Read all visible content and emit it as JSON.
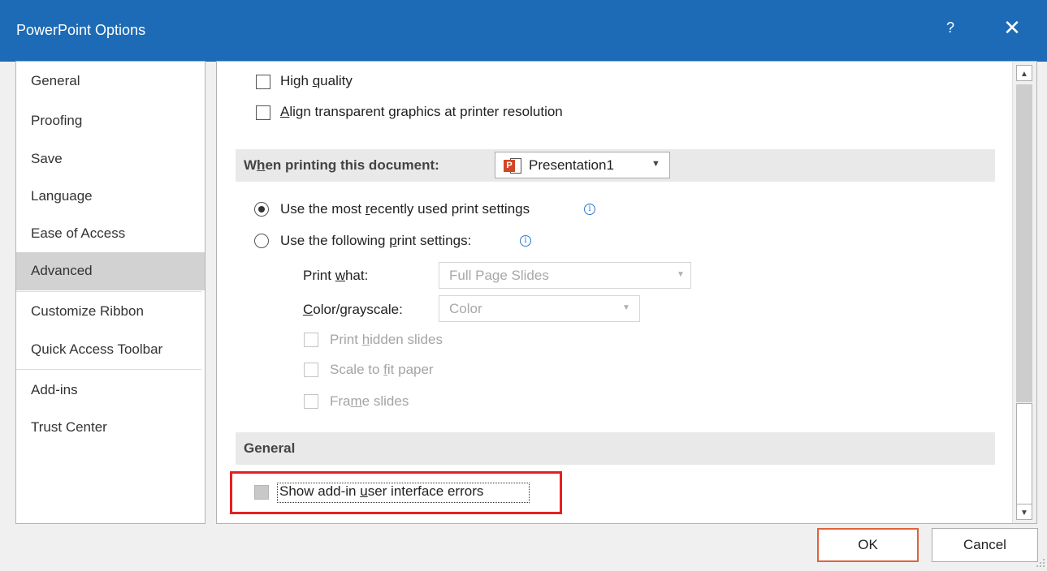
{
  "window": {
    "title": "PowerPoint Options",
    "help_label": "?",
    "close_label": "✕"
  },
  "sidebar": {
    "items": [
      {
        "label": "General"
      },
      {
        "label": "Proofing"
      },
      {
        "label": "Save"
      },
      {
        "label": "Language"
      },
      {
        "label": "Ease of Access"
      },
      {
        "label": "Advanced",
        "selected": true
      },
      {
        "label": "Customize Ribbon"
      },
      {
        "label": "Quick Access Toolbar"
      },
      {
        "label": "Add-ins"
      },
      {
        "label": "Trust Center"
      }
    ]
  },
  "print_options": {
    "high_quality": {
      "pre": "High ",
      "ul": "q",
      "post": "uality",
      "checked": false
    },
    "align_transparent": {
      "pre": "",
      "ul": "A",
      "post": "lign transparent graphics at printer resolution",
      "checked": false
    }
  },
  "when_printing": {
    "title_pre": "W",
    "title_ul": "h",
    "title_post": "en printing this document:",
    "document": "Presentation1",
    "document_icon_letter": "P",
    "radio_recent": {
      "pre": "Use the most ",
      "ul": "r",
      "post": "ecently used print settings",
      "selected": true
    },
    "radio_following": {
      "pre": "Use the following ",
      "ul": "p",
      "post": "rint settings:",
      "selected": false
    },
    "print_what": {
      "pre": "Print ",
      "ul": "w",
      "post": "hat:",
      "value": "Full Page Slides"
    },
    "color_grayscale": {
      "pre": "",
      "ul": "C",
      "post": "olor/grayscale:",
      "value": "Color"
    },
    "print_hidden": {
      "pre": "Print ",
      "ul": "h",
      "post": "idden slides"
    },
    "scale_fit": {
      "pre": "Scale to ",
      "ul": "f",
      "post": "it paper"
    },
    "frame_slides": {
      "pre": "Fra",
      "ul": "m",
      "post": "e slides"
    }
  },
  "general_section": {
    "title": "General",
    "show_addin_errors": {
      "pre": "Show add-in ",
      "ul": "u",
      "post": "ser interface errors",
      "checked": false
    }
  },
  "buttons": {
    "ok": "OK",
    "cancel": "Cancel"
  },
  "colors": {
    "titlebar": "#1d6bb6",
    "highlight_box": "#e81f1f",
    "ok_border": "#e0623b"
  }
}
